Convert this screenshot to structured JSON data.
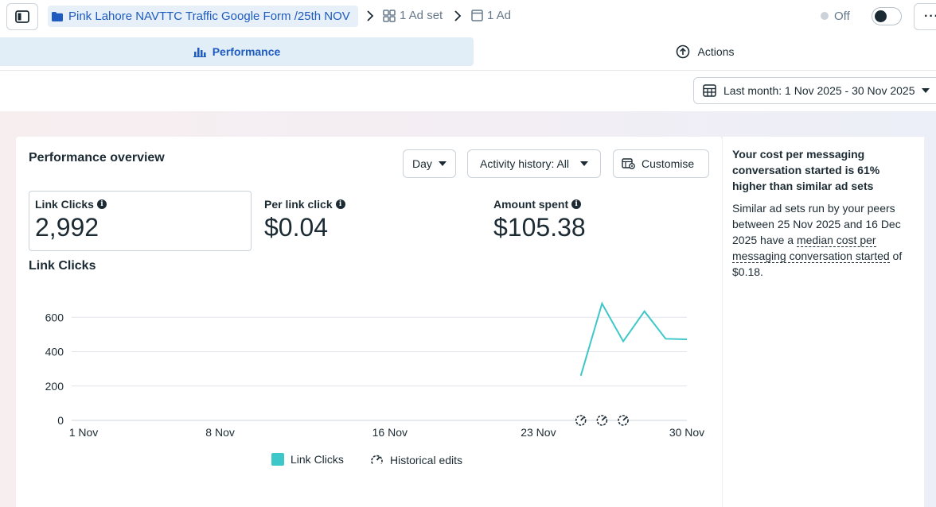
{
  "breadcrumb": {
    "campaign": "Pink Lahore NAVTTC Traffic Google Form /25th NOV",
    "ad_set": "1 Ad set",
    "ad": "1 Ad"
  },
  "status": {
    "label": "Off",
    "toggle_on": false
  },
  "tabs": {
    "performance": "Performance",
    "actions": "Actions"
  },
  "date_range": {
    "label": "Last month: 1 Nov 2025 - 30 Nov 2025"
  },
  "overview": {
    "title": "Performance overview",
    "granularity": "Day",
    "activity_history": "Activity history: All",
    "customise": "Customise"
  },
  "metrics": [
    {
      "label": "Link Clicks",
      "value": "2,992"
    },
    {
      "label": "Per link click",
      "value": "$0.04"
    },
    {
      "label": "Amount spent",
      "value": "$105.38"
    }
  ],
  "chart": {
    "title": "Link Clicks",
    "legend": {
      "series": "Link Clicks",
      "edits": "Historical edits"
    }
  },
  "chart_data": {
    "type": "line",
    "x_ticks": [
      "1 Nov",
      "8 Nov",
      "16 Nov",
      "23 Nov",
      "30 Nov"
    ],
    "y_ticks": [
      0,
      200,
      400,
      600
    ],
    "ylim": [
      0,
      680
    ],
    "xlim": [
      1,
      30
    ],
    "grid": true,
    "legend_placement": "bottom",
    "series": [
      {
        "name": "Link Clicks",
        "color": "#3ec7c9",
        "x": [
          25,
          26,
          27,
          28,
          29,
          30
        ],
        "y": [
          260,
          680,
          460,
          635,
          475,
          472
        ]
      }
    ],
    "historical_edits_x": [
      25,
      26,
      27
    ]
  },
  "insight": {
    "title": "Your cost per messaging conversation started is 61% higher than similar ad sets",
    "body_pre": "Similar ad sets run by your peers between 25 Nov 2025 and 16 Dec 2025 have a ",
    "body_link": "median cost per messaging conversation started",
    "body_post": " of $0.18."
  },
  "colors": {
    "accent": "#1d5bbf",
    "series": "#3ec7c9",
    "tab_bg": "#e1edf7"
  }
}
